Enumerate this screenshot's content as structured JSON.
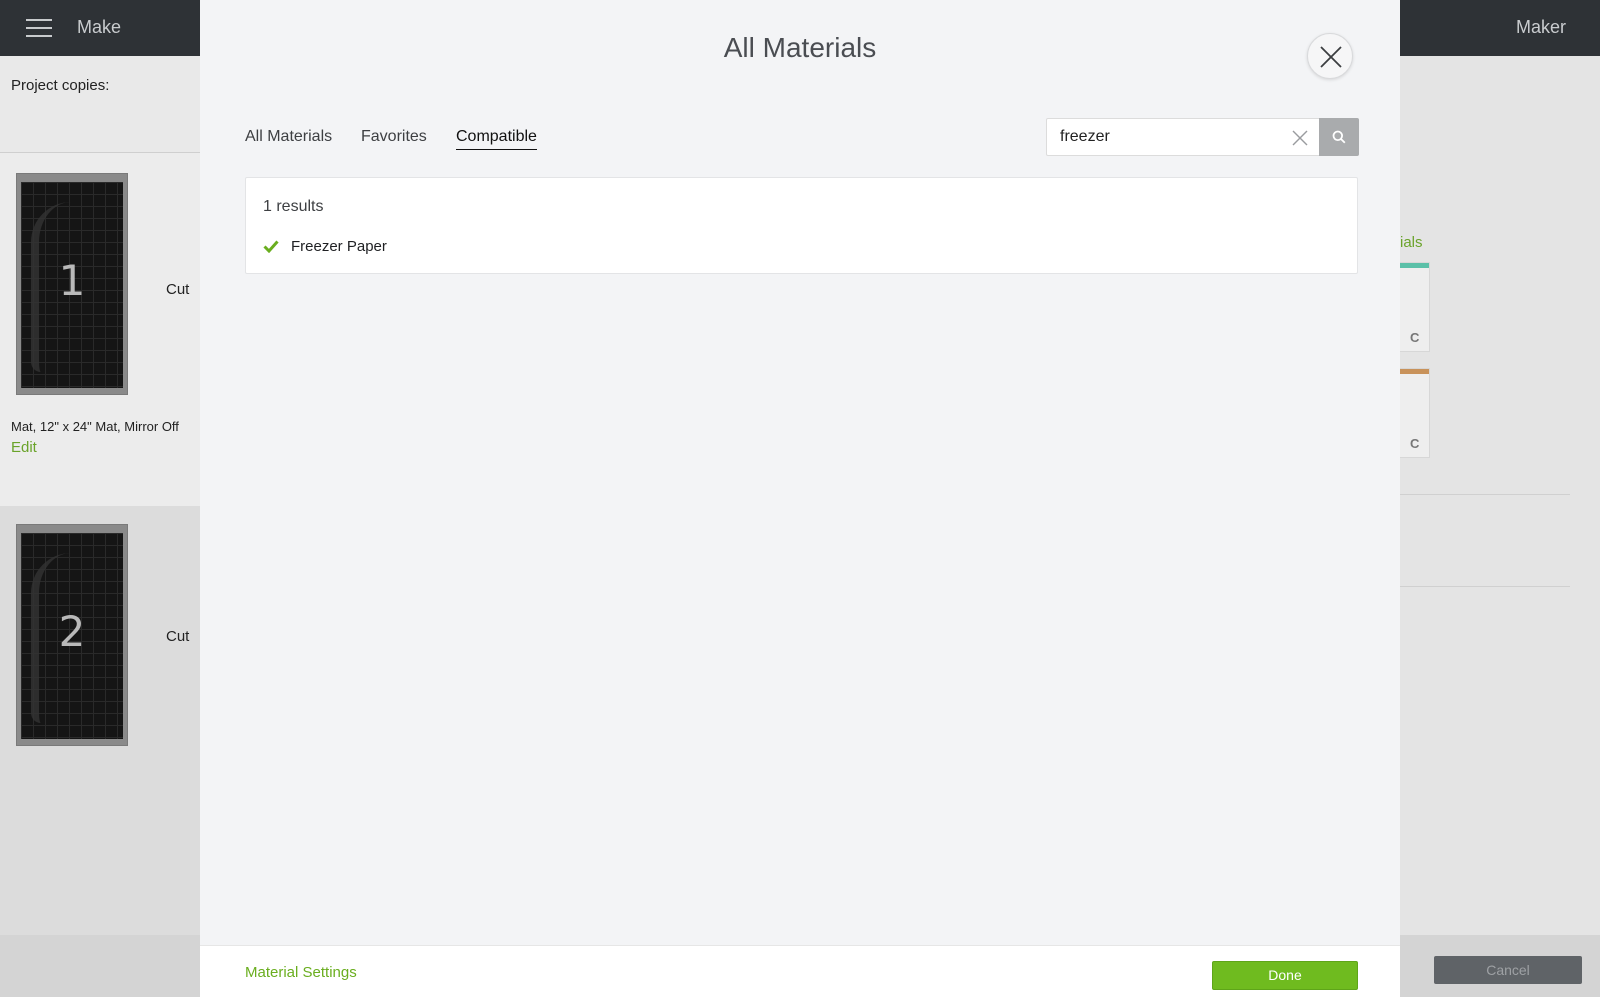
{
  "app": {
    "header_title": "Make",
    "header_right": "Maker"
  },
  "left_panel": {
    "copies_label": "Project copies:",
    "mats": [
      {
        "number": "1",
        "action": "Cut"
      },
      {
        "number": "2",
        "action": "Cut"
      }
    ],
    "mat_info": "Mat, 12\" x 24\" Mat, Mirror Off",
    "edit_label": "Edit"
  },
  "right_panel": {
    "partial_link": "ials",
    "cards": [
      {
        "letter": "C",
        "stripe_color": "#5bc0a8"
      },
      {
        "letter": "C",
        "stripe_color": "#c8925a"
      }
    ],
    "cancel_label": "Cancel"
  },
  "modal": {
    "title": "All Materials",
    "tabs": [
      {
        "label": "All Materials",
        "active": false
      },
      {
        "label": "Favorites",
        "active": false
      },
      {
        "label": "Compatible",
        "active": true
      }
    ],
    "search": {
      "value": "freezer",
      "placeholder": ""
    },
    "results": {
      "count_text": "1 results",
      "items": [
        {
          "label": "Freezer Paper",
          "selected": true
        }
      ]
    },
    "footer": {
      "settings_label": "Material Settings",
      "done_label": "Done"
    }
  },
  "colors": {
    "accent_green": "#6fbb1f",
    "header_dark": "#2e3236",
    "check_green": "#6aae1f"
  },
  "icons": [
    "hamburger-icon",
    "close-icon",
    "clear-search-icon",
    "search-icon",
    "check-icon"
  ]
}
